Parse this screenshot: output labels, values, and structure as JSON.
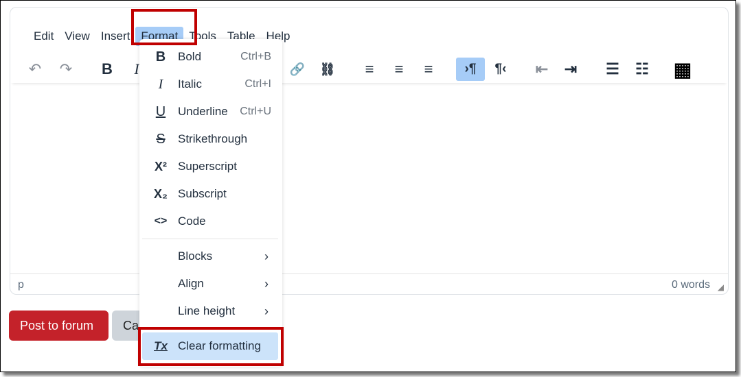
{
  "menubar": [
    "Edit",
    "View",
    "Insert",
    "Format",
    "Tools",
    "Table",
    "Help"
  ],
  "toolbar": {
    "undo": "↶",
    "redo": "↷",
    "bold": "B",
    "italic": "I",
    "link": "🔗",
    "unlink": "⛓",
    "align_left": "≡",
    "align_center": "≡",
    "align_right": "≡",
    "ltr": "›¶",
    "rtl": "¶‹",
    "outdent": "⇤",
    "indent": "⇥",
    "bullist": "☰",
    "numlist": "☷",
    "calculator": "▦"
  },
  "format_menu": [
    {
      "icon": "B",
      "label": "Bold",
      "shortcut": "Ctrl+B"
    },
    {
      "icon": "I",
      "label": "Italic",
      "shortcut": "Ctrl+I"
    },
    {
      "icon": "U",
      "label": "Underline",
      "shortcut": "Ctrl+U"
    },
    {
      "icon": "S",
      "label": "Strikethrough"
    },
    {
      "icon": "X²",
      "label": "Superscript"
    },
    {
      "icon": "X₂",
      "label": "Subscript"
    },
    {
      "icon": "<>",
      "label": "Code"
    },
    {
      "label": "Blocks",
      "submenu": "›"
    },
    {
      "label": "Align",
      "submenu": "›"
    },
    {
      "label": "Line height",
      "submenu": "›"
    },
    {
      "icon": "Tx",
      "label": "Clear formatting"
    }
  ],
  "status": {
    "path": "p",
    "words": "0 words"
  },
  "buttons": {
    "post": "Post to forum",
    "cancel": "Cancel"
  },
  "colors": {
    "accent": "#a6ccf7",
    "post_button": "#c4222a",
    "highlight_box": "#c00000"
  }
}
